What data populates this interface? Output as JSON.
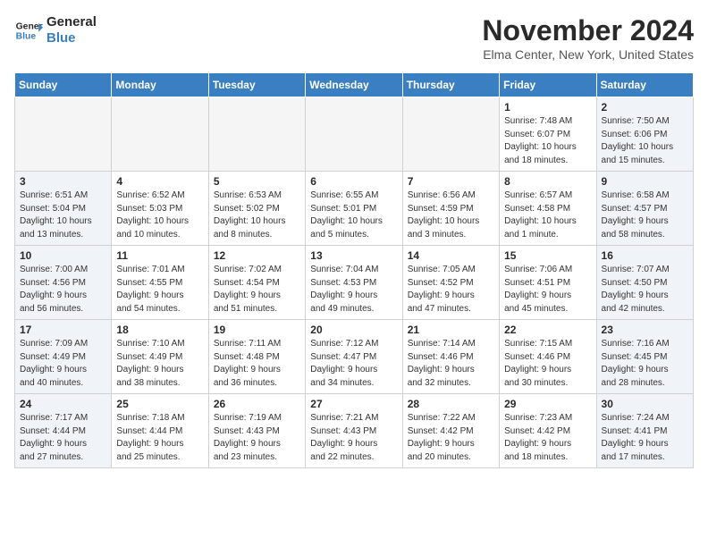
{
  "header": {
    "logo_line1": "General",
    "logo_line2": "Blue",
    "month_title": "November 2024",
    "location": "Elma Center, New York, United States"
  },
  "days_of_week": [
    "Sunday",
    "Monday",
    "Tuesday",
    "Wednesday",
    "Thursday",
    "Friday",
    "Saturday"
  ],
  "weeks": [
    [
      {
        "num": "",
        "info": ""
      },
      {
        "num": "",
        "info": ""
      },
      {
        "num": "",
        "info": ""
      },
      {
        "num": "",
        "info": ""
      },
      {
        "num": "",
        "info": ""
      },
      {
        "num": "1",
        "info": "Sunrise: 7:48 AM\nSunset: 6:07 PM\nDaylight: 10 hours\nand 18 minutes."
      },
      {
        "num": "2",
        "info": "Sunrise: 7:50 AM\nSunset: 6:06 PM\nDaylight: 10 hours\nand 15 minutes."
      }
    ],
    [
      {
        "num": "3",
        "info": "Sunrise: 6:51 AM\nSunset: 5:04 PM\nDaylight: 10 hours\nand 13 minutes."
      },
      {
        "num": "4",
        "info": "Sunrise: 6:52 AM\nSunset: 5:03 PM\nDaylight: 10 hours\nand 10 minutes."
      },
      {
        "num": "5",
        "info": "Sunrise: 6:53 AM\nSunset: 5:02 PM\nDaylight: 10 hours\nand 8 minutes."
      },
      {
        "num": "6",
        "info": "Sunrise: 6:55 AM\nSunset: 5:01 PM\nDaylight: 10 hours\nand 5 minutes."
      },
      {
        "num": "7",
        "info": "Sunrise: 6:56 AM\nSunset: 4:59 PM\nDaylight: 10 hours\nand 3 minutes."
      },
      {
        "num": "8",
        "info": "Sunrise: 6:57 AM\nSunset: 4:58 PM\nDaylight: 10 hours\nand 1 minute."
      },
      {
        "num": "9",
        "info": "Sunrise: 6:58 AM\nSunset: 4:57 PM\nDaylight: 9 hours\nand 58 minutes."
      }
    ],
    [
      {
        "num": "10",
        "info": "Sunrise: 7:00 AM\nSunset: 4:56 PM\nDaylight: 9 hours\nand 56 minutes."
      },
      {
        "num": "11",
        "info": "Sunrise: 7:01 AM\nSunset: 4:55 PM\nDaylight: 9 hours\nand 54 minutes."
      },
      {
        "num": "12",
        "info": "Sunrise: 7:02 AM\nSunset: 4:54 PM\nDaylight: 9 hours\nand 51 minutes."
      },
      {
        "num": "13",
        "info": "Sunrise: 7:04 AM\nSunset: 4:53 PM\nDaylight: 9 hours\nand 49 minutes."
      },
      {
        "num": "14",
        "info": "Sunrise: 7:05 AM\nSunset: 4:52 PM\nDaylight: 9 hours\nand 47 minutes."
      },
      {
        "num": "15",
        "info": "Sunrise: 7:06 AM\nSunset: 4:51 PM\nDaylight: 9 hours\nand 45 minutes."
      },
      {
        "num": "16",
        "info": "Sunrise: 7:07 AM\nSunset: 4:50 PM\nDaylight: 9 hours\nand 42 minutes."
      }
    ],
    [
      {
        "num": "17",
        "info": "Sunrise: 7:09 AM\nSunset: 4:49 PM\nDaylight: 9 hours\nand 40 minutes."
      },
      {
        "num": "18",
        "info": "Sunrise: 7:10 AM\nSunset: 4:49 PM\nDaylight: 9 hours\nand 38 minutes."
      },
      {
        "num": "19",
        "info": "Sunrise: 7:11 AM\nSunset: 4:48 PM\nDaylight: 9 hours\nand 36 minutes."
      },
      {
        "num": "20",
        "info": "Sunrise: 7:12 AM\nSunset: 4:47 PM\nDaylight: 9 hours\nand 34 minutes."
      },
      {
        "num": "21",
        "info": "Sunrise: 7:14 AM\nSunset: 4:46 PM\nDaylight: 9 hours\nand 32 minutes."
      },
      {
        "num": "22",
        "info": "Sunrise: 7:15 AM\nSunset: 4:46 PM\nDaylight: 9 hours\nand 30 minutes."
      },
      {
        "num": "23",
        "info": "Sunrise: 7:16 AM\nSunset: 4:45 PM\nDaylight: 9 hours\nand 28 minutes."
      }
    ],
    [
      {
        "num": "24",
        "info": "Sunrise: 7:17 AM\nSunset: 4:44 PM\nDaylight: 9 hours\nand 27 minutes."
      },
      {
        "num": "25",
        "info": "Sunrise: 7:18 AM\nSunset: 4:44 PM\nDaylight: 9 hours\nand 25 minutes."
      },
      {
        "num": "26",
        "info": "Sunrise: 7:19 AM\nSunset: 4:43 PM\nDaylight: 9 hours\nand 23 minutes."
      },
      {
        "num": "27",
        "info": "Sunrise: 7:21 AM\nSunset: 4:43 PM\nDaylight: 9 hours\nand 22 minutes."
      },
      {
        "num": "28",
        "info": "Sunrise: 7:22 AM\nSunset: 4:42 PM\nDaylight: 9 hours\nand 20 minutes."
      },
      {
        "num": "29",
        "info": "Sunrise: 7:23 AM\nSunset: 4:42 PM\nDaylight: 9 hours\nand 18 minutes."
      },
      {
        "num": "30",
        "info": "Sunrise: 7:24 AM\nSunset: 4:41 PM\nDaylight: 9 hours\nand 17 minutes."
      }
    ]
  ]
}
